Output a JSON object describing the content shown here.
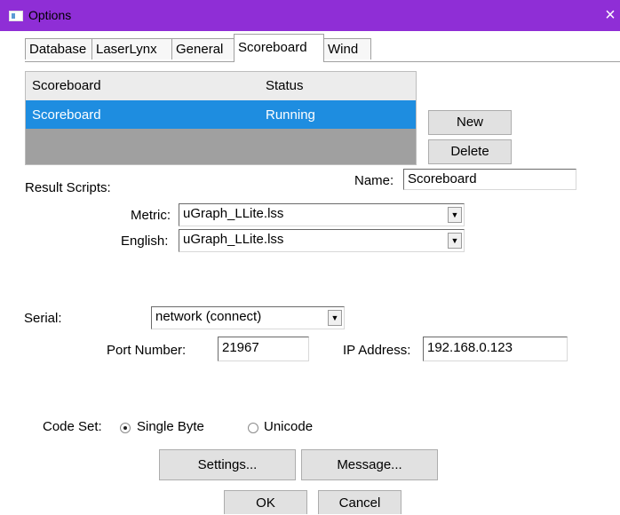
{
  "window": {
    "title": "Options",
    "close_glyph": "×"
  },
  "tabs": [
    {
      "label": "Database",
      "active": false
    },
    {
      "label": "LaserLynx",
      "active": false
    },
    {
      "label": "General",
      "active": false
    },
    {
      "label": "Scoreboard",
      "active": true
    },
    {
      "label": "Wind",
      "active": false
    }
  ],
  "list": {
    "columns": [
      "Scoreboard",
      "Status"
    ],
    "rows": [
      {
        "scoreboard": "Scoreboard",
        "status": "Running",
        "selected": true
      }
    ]
  },
  "buttons": {
    "new": "New",
    "delete": "Delete",
    "settings": "Settings...",
    "message": "Message...",
    "ok": "OK",
    "cancel": "Cancel"
  },
  "name_field": {
    "label": "Name:",
    "value": "Scoreboard"
  },
  "result_scripts": {
    "label": "Result Scripts:",
    "metric": {
      "label": "Metric:",
      "value": "uGraph_LLite.lss"
    },
    "english": {
      "label": "English:",
      "value": "uGraph_LLite.lss"
    }
  },
  "serial": {
    "label": "Serial:",
    "value": "network (connect)"
  },
  "port": {
    "label": "Port Number:",
    "value": "21967"
  },
  "ip": {
    "label": "IP Address:",
    "value": "192.168.0.123"
  },
  "code_set": {
    "label": "Code Set:",
    "options": [
      {
        "label": "Single Byte",
        "checked": true
      },
      {
        "label": "Unicode",
        "checked": false
      }
    ]
  },
  "colors": {
    "titlebar": "#8f2ed6",
    "selection": "#1e8de0",
    "list_bg": "#a0a0a0"
  },
  "icons": {
    "dropdown": "chevron-down-icon",
    "window": "window-icon",
    "close": "close-icon"
  }
}
